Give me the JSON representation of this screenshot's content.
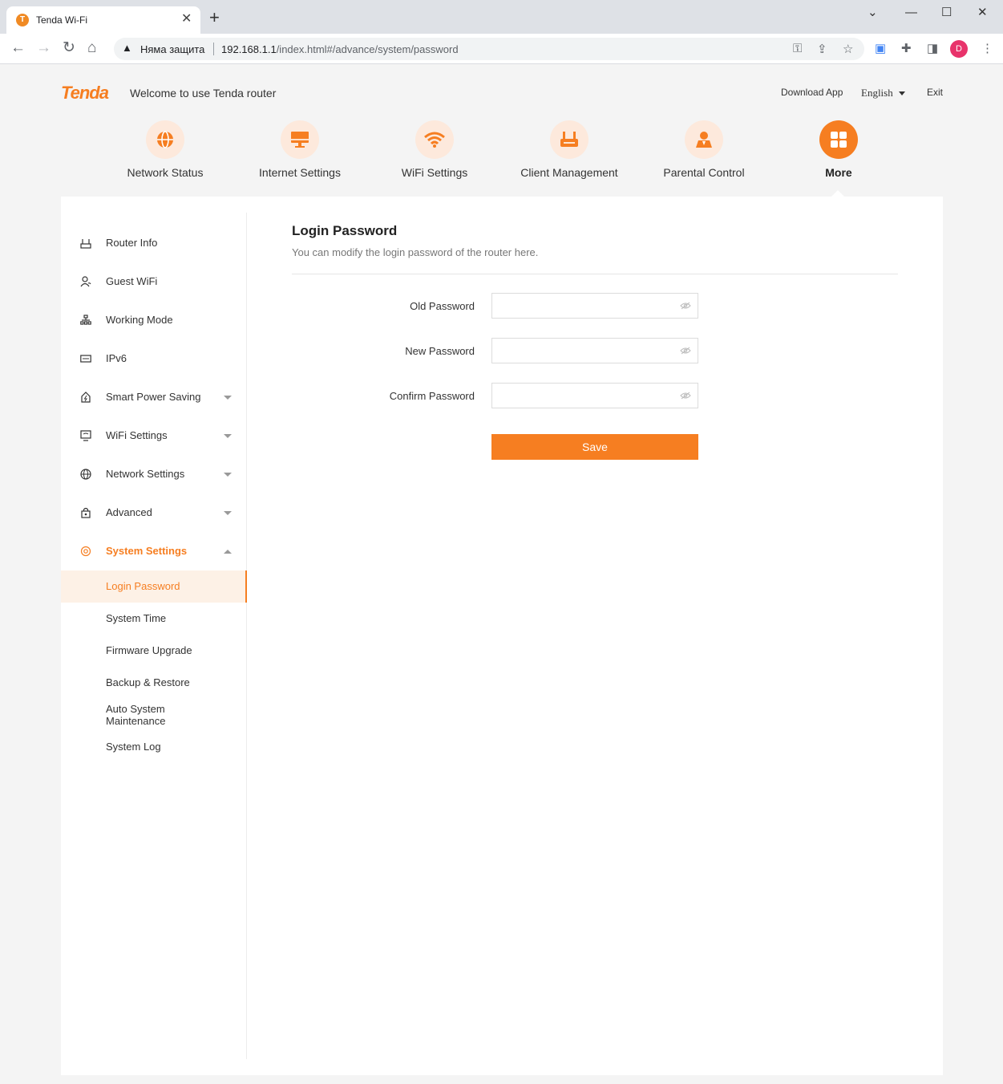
{
  "browser": {
    "tab_title": "Tenda Wi-Fi",
    "tab_favicon": "tenda-favicon",
    "security_text": "Няма защита",
    "url_host": "192.168.1.1",
    "url_path": "/index.html#/advance/system/password",
    "profile_initial": "D"
  },
  "header": {
    "logo_text": "Tenda",
    "welcome": "Welcome to use Tenda router",
    "download_app": "Download App",
    "language": "English",
    "exit": "Exit"
  },
  "top_nav": [
    {
      "label": "Network Status",
      "icon": "globe-icon"
    },
    {
      "label": "Internet Settings",
      "icon": "monitor-icon"
    },
    {
      "label": "WiFi Settings",
      "icon": "wifi-icon"
    },
    {
      "label": "Client Management",
      "icon": "router-icon"
    },
    {
      "label": "Parental Control",
      "icon": "person-icon"
    },
    {
      "label": "More",
      "icon": "grid-icon",
      "active": true
    }
  ],
  "sidebar": {
    "items": [
      {
        "label": "Router Info"
      },
      {
        "label": "Guest WiFi"
      },
      {
        "label": "Working Mode"
      },
      {
        "label": "IPv6"
      },
      {
        "label": "Smart Power Saving"
      },
      {
        "label": "WiFi Settings"
      },
      {
        "label": "Network Settings"
      },
      {
        "label": "Advanced"
      },
      {
        "label": "System Settings",
        "expanded": true
      }
    ],
    "sub_items": [
      {
        "label": "Login Password",
        "active": true
      },
      {
        "label": "System Time"
      },
      {
        "label": "Firmware Upgrade"
      },
      {
        "label": "Backup & Restore"
      },
      {
        "label": "Auto System Maintenance"
      },
      {
        "label": "System Log"
      }
    ]
  },
  "content": {
    "title": "Login Password",
    "description": "You can modify the login password of the router here.",
    "fields": [
      {
        "label": "Old Password",
        "value": ""
      },
      {
        "label": "New Password",
        "value": ""
      },
      {
        "label": "Confirm Password",
        "value": ""
      }
    ],
    "save_label": "Save"
  },
  "colors": {
    "accent": "#f67e21",
    "accent_light": "#fde9dc"
  }
}
